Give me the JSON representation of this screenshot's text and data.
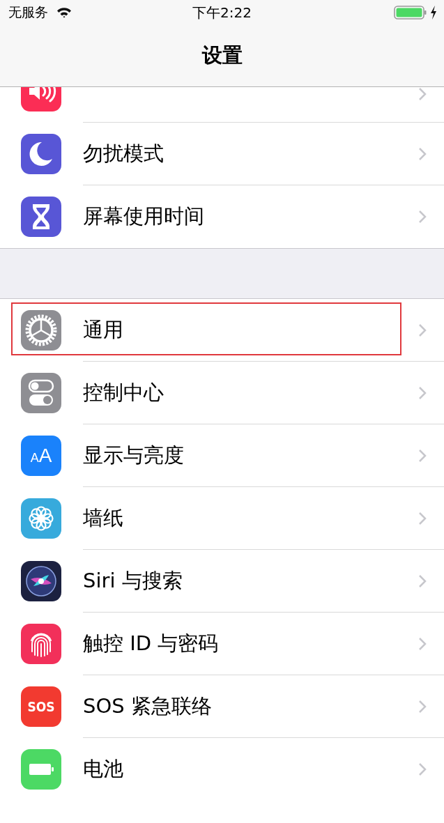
{
  "status_bar": {
    "carrier": "无服务",
    "time": "下午2:22",
    "battery_charging": true
  },
  "nav": {
    "title": "设置"
  },
  "groups": [
    {
      "items": [
        {
          "kind": "speaker",
          "highlighted": false
        },
        {
          "label": "勿扰模式",
          "kind": "moon",
          "highlighted": false
        },
        {
          "label": "屏幕使用时间",
          "kind": "hourglass",
          "highlighted": false
        }
      ]
    },
    {
      "items": [
        {
          "label": "通用",
          "kind": "gear",
          "highlighted": true
        },
        {
          "label": "控制中心",
          "kind": "toggles",
          "highlighted": false
        },
        {
          "label": "显示与亮度",
          "kind": "textsize",
          "icon_text": "AA",
          "highlighted": false
        },
        {
          "label": "墙纸",
          "kind": "flower",
          "highlighted": false
        },
        {
          "label": "Siri 与搜索",
          "kind": "orb",
          "highlighted": false
        },
        {
          "label": "触控 ID 与密码",
          "kind": "fingerprint",
          "highlighted": false
        },
        {
          "label": "SOS 紧急联络",
          "kind": "sos",
          "icon_text": "SOS",
          "highlighted": false
        },
        {
          "label": "电池",
          "kind": "battery",
          "highlighted": false
        }
      ]
    }
  ]
}
